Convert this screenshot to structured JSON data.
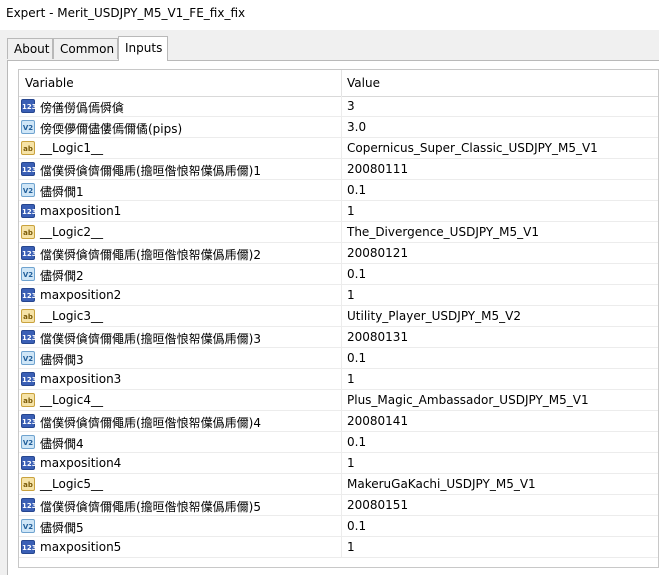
{
  "window": {
    "title": "Expert - Merit_USDJPY_M5_V1_FE_fix_fix"
  },
  "tabs": [
    {
      "label": "About",
      "active": false
    },
    {
      "label": "Common",
      "active": false
    },
    {
      "label": "Inputs",
      "active": true
    }
  ],
  "grid": {
    "columns": {
      "variable": "Variable",
      "value": "Value"
    },
    "rows": [
      {
        "icon": "int-type-icon",
        "type_label": "123",
        "name": "傍僐僗僞傿僢僋",
        "value": "3"
      },
      {
        "icon": "double-type-icon",
        "type_label": "V2",
        "name": "傍偄儚儞儘僂傿儞僪(pips)",
        "value": "3.0"
      },
      {
        "icon": "string-type-icon",
        "type_label": "ab",
        "name": "__Logic1__",
        "value": "Copernicus_Super_Classic_USDJPY_M5_V1"
      },
      {
        "icon": "int-type-icon",
        "type_label": "123",
        "name": "儅僕僢僋儕儞僶乕(擔晅偺悢帤僷僞乕儞)1",
        "value": "20080111"
      },
      {
        "icon": "double-type-icon",
        "type_label": "V2",
        "name": "儘僢僩1",
        "value": "0.1"
      },
      {
        "icon": "int-type-icon",
        "type_label": "123",
        "name": "maxposition1",
        "value": "1"
      },
      {
        "icon": "string-type-icon",
        "type_label": "ab",
        "name": "__Logic2__",
        "value": "The_Divergence_USDJPY_M5_V1"
      },
      {
        "icon": "int-type-icon",
        "type_label": "123",
        "name": "儅僕僢僋儕儞僶乕(擔晅偺悢帤僷僞乕儞)2",
        "value": "20080121"
      },
      {
        "icon": "double-type-icon",
        "type_label": "V2",
        "name": "儘僢僩2",
        "value": "0.1"
      },
      {
        "icon": "int-type-icon",
        "type_label": "123",
        "name": "maxposition2",
        "value": "1"
      },
      {
        "icon": "string-type-icon",
        "type_label": "ab",
        "name": "__Logic3__",
        "value": "Utility_Player_USDJPY_M5_V2"
      },
      {
        "icon": "int-type-icon",
        "type_label": "123",
        "name": "儅僕僢僋儕儞僶乕(擔晅偺悢帤僷僞乕儞)3",
        "value": "20080131"
      },
      {
        "icon": "double-type-icon",
        "type_label": "V2",
        "name": "儘僢僩3",
        "value": "0.1"
      },
      {
        "icon": "int-type-icon",
        "type_label": "123",
        "name": "maxposition3",
        "value": "1"
      },
      {
        "icon": "string-type-icon",
        "type_label": "ab",
        "name": "__Logic4__",
        "value": "Plus_Magic_Ambassador_USDJPY_M5_V1"
      },
      {
        "icon": "int-type-icon",
        "type_label": "123",
        "name": "儅僕僢僋儕儞僶乕(擔晅偺悢帤僷僞乕儞)4",
        "value": "20080141"
      },
      {
        "icon": "double-type-icon",
        "type_label": "V2",
        "name": "儘僢僩4",
        "value": "0.1"
      },
      {
        "icon": "int-type-icon",
        "type_label": "123",
        "name": "maxposition4",
        "value": "1"
      },
      {
        "icon": "string-type-icon",
        "type_label": "ab",
        "name": "__Logic5__",
        "value": "MakeruGaKachi_USDJPY_M5_V1"
      },
      {
        "icon": "int-type-icon",
        "type_label": "123",
        "name": "儅僕僢僋儕儞僶乕(擔晅偺悢帤僷僞乕儞)5",
        "value": "20080151"
      },
      {
        "icon": "double-type-icon",
        "type_label": "V2",
        "name": "儘僢僩5",
        "value": "0.1"
      },
      {
        "icon": "int-type-icon",
        "type_label": "123",
        "name": "maxposition5",
        "value": "1"
      }
    ]
  }
}
